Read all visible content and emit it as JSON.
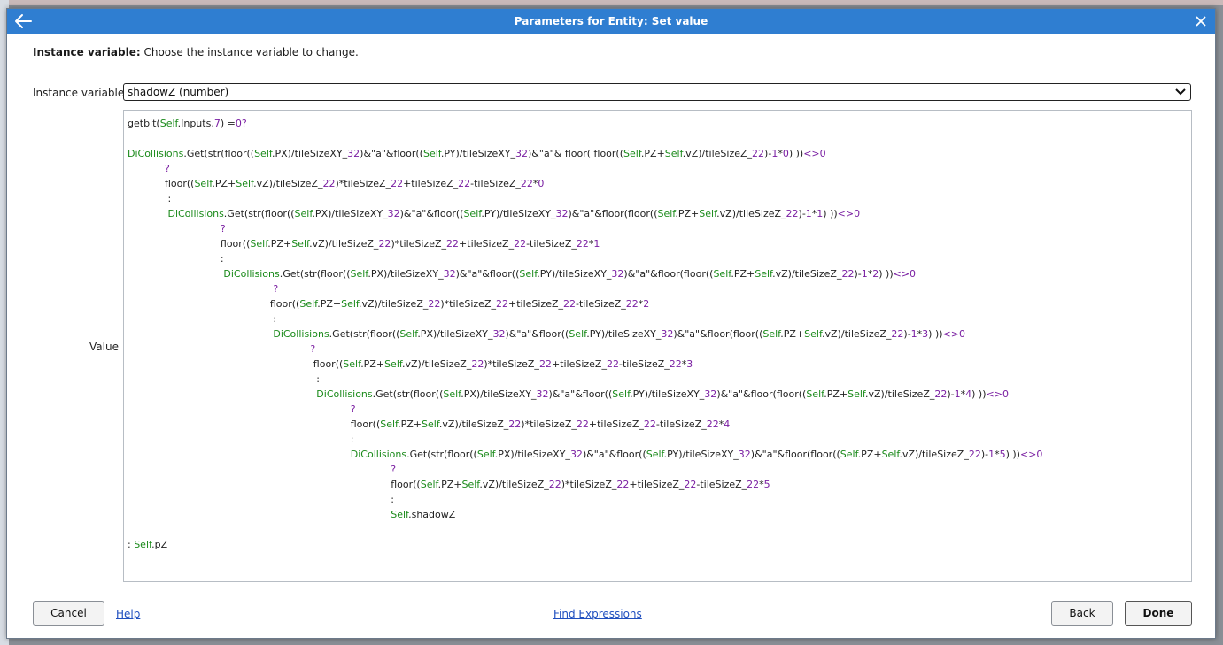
{
  "dialog": {
    "title": "Parameters for Entity: Set value",
    "param_heading": "Instance variable:",
    "param_description": " Choose the instance variable to change.",
    "instance_label": "Instance variable",
    "instance_value": "shadowZ (number)",
    "value_label": "Value"
  },
  "code_lines": [
    "getbit(Self.Inputs,7) =0?",
    "",
    "DiCollisions.Get(str(floor((Self.PX)/tileSizeXY_32)&\"a\"&floor((Self.PY)/tileSizeXY_32)&\"a\"& floor( floor((Self.PZ+Self.vZ)/tileSizeZ_22)-1*0) ))<>0",
    "            ?",
    "            floor((Self.PZ+Self.vZ)/tileSizeZ_22)*tileSizeZ_22+tileSizeZ_22-tileSizeZ_22*0",
    "             :",
    "             DiCollisions.Get(str(floor((Self.PX)/tileSizeXY_32)&\"a\"&floor((Self.PY)/tileSizeXY_32)&\"a\"&floor(floor((Self.PZ+Self.vZ)/tileSizeZ_22)-1*1) ))<>0",
    "                              ?",
    "                              floor((Self.PZ+Self.vZ)/tileSizeZ_22)*tileSizeZ_22+tileSizeZ_22-tileSizeZ_22*1",
    "                              :",
    "                               DiCollisions.Get(str(floor((Self.PX)/tileSizeXY_32)&\"a\"&floor((Self.PY)/tileSizeXY_32)&\"a\"&floor(floor((Self.PZ+Self.vZ)/tileSizeZ_22)-1*2) ))<>0",
    "                                               ?",
    "                                              floor((Self.PZ+Self.vZ)/tileSizeZ_22)*tileSizeZ_22+tileSizeZ_22-tileSizeZ_22*2",
    "                                               :",
    "                                               DiCollisions.Get(str(floor((Self.PX)/tileSizeXY_32)&\"a\"&floor((Self.PY)/tileSizeXY_32)&\"a\"&floor(floor((Self.PZ+Self.vZ)/tileSizeZ_22)-1*3) ))<>0",
    "                                                           ?",
    "                                                            floor((Self.PZ+Self.vZ)/tileSizeZ_22)*tileSizeZ_22+tileSizeZ_22-tileSizeZ_22*3",
    "                                                             :",
    "                                                             DiCollisions.Get(str(floor((Self.PX)/tileSizeXY_32)&\"a\"&floor((Self.PY)/tileSizeXY_32)&\"a\"&floor(floor((Self.PZ+Self.vZ)/tileSizeZ_22)-1*4) ))<>0",
    "                                                                        ?",
    "                                                                        floor((Self.PZ+Self.vZ)/tileSizeZ_22)*tileSizeZ_22+tileSizeZ_22-tileSizeZ_22*4",
    "                                                                        :",
    "                                                                        DiCollisions.Get(str(floor((Self.PX)/tileSizeXY_32)&\"a\"&floor((Self.PY)/tileSizeXY_32)&\"a\"&floor(floor((Self.PZ+Self.vZ)/tileSizeZ_22)-1*5) ))<>0",
    "                                                                                     ?",
    "                                                                                     floor((Self.PZ+Self.vZ)/tileSizeZ_22)*tileSizeZ_22+tileSizeZ_22-tileSizeZ_22*5",
    "                                                                                     :",
    "                                                                                     Self.shadowZ",
    "",
    ": Self.pZ"
  ],
  "buttons": {
    "cancel": "Cancel",
    "help": "Help",
    "find_expressions": "Find Expressions",
    "back": "Back",
    "done": "Done"
  },
  "icons": {
    "back": "back-arrow-icon",
    "close": "close-icon",
    "dropdown": "chevron-down-icon"
  },
  "colors": {
    "titlebar": "#2f7ed1",
    "object_green": "#1a8a1a",
    "number_purple": "#7a1fa2"
  }
}
